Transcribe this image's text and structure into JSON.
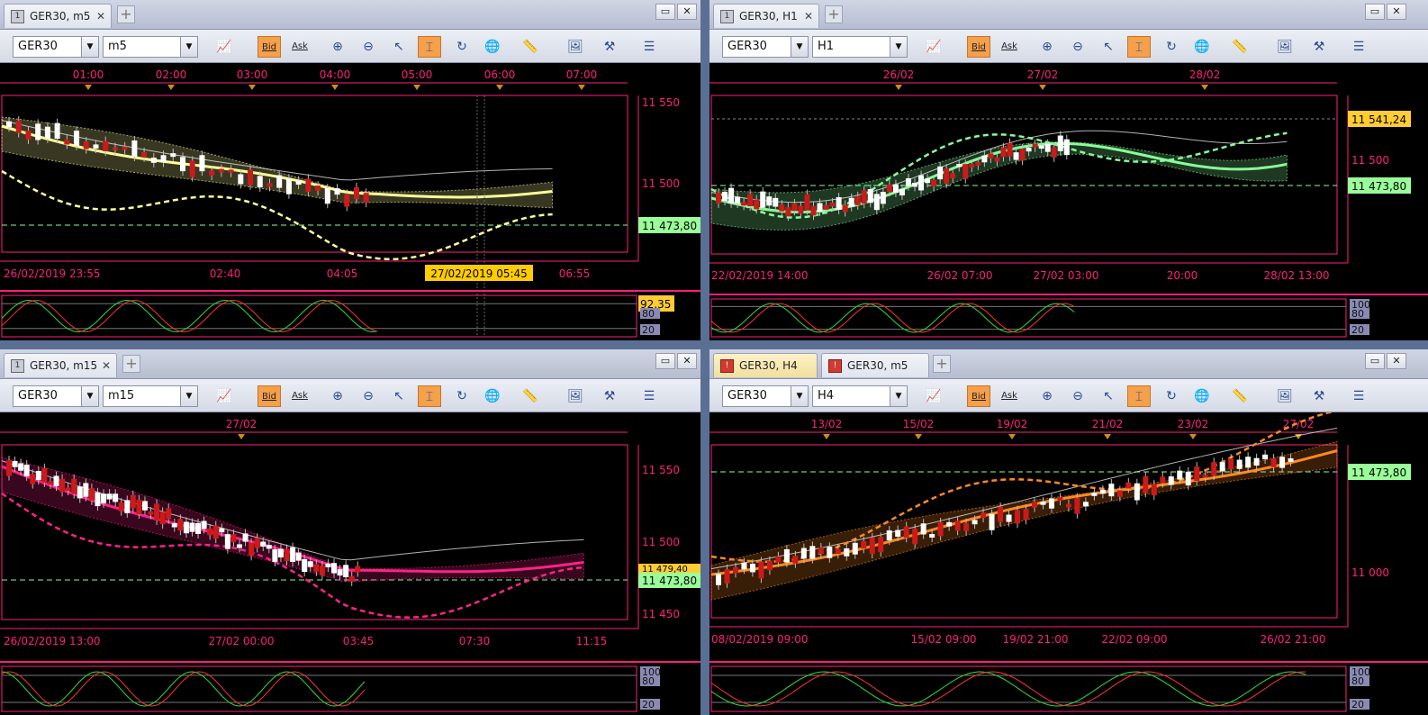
{
  "panes": [
    {
      "id": "tl",
      "tabs": [
        {
          "label": "GER30, m5",
          "active": false,
          "icon": "gray"
        }
      ],
      "symbol": "GER30",
      "timeframe": "m5",
      "bid_label": "Bid",
      "ask_label": "Ask",
      "top_axis": [
        "01:00",
        "02:00",
        "03:00",
        "04:00",
        "05:00",
        "06:00",
        "07:00"
      ],
      "price_labels": [
        "11 550",
        "11 500"
      ],
      "current_price": "11 473,80",
      "bottom_axis": [
        "26/02/2019 23:55",
        "02:40",
        "04:05",
        "06:55"
      ],
      "cursor_label": "27/02/2019 05:45",
      "osc_value": "92,35",
      "osc_levels": [
        "80",
        "20"
      ],
      "color": "#ffff99"
    },
    {
      "id": "tr",
      "tabs": [
        {
          "label": "GER30, H1",
          "active": false,
          "icon": "gray"
        }
      ],
      "symbol": "GER30",
      "timeframe": "H1",
      "bid_label": "Bid",
      "ask_label": "Ask",
      "top_axis": [
        "26/02",
        "27/02",
        "28/02"
      ],
      "price_labels": [
        "11 500"
      ],
      "high_price": "11 541,24",
      "current_price": "11 473,80",
      "bottom_axis": [
        "22/02/2019 14:00",
        "26/02 07:00",
        "27/02 03:00",
        "20:00",
        "28/02 13:00"
      ],
      "osc_levels": [
        "100",
        "80",
        "20"
      ],
      "color": "#88ff99"
    },
    {
      "id": "bl",
      "tabs": [
        {
          "label": "GER30, m15",
          "active": false,
          "icon": "gray"
        }
      ],
      "symbol": "GER30",
      "timeframe": "m15",
      "bid_label": "Bid",
      "ask_label": "Ask",
      "top_axis": [
        "27/02"
      ],
      "price_labels": [
        "11 550",
        "11 500",
        "11 450"
      ],
      "extra_price": "11 479,40",
      "current_price": "11 473,80",
      "bottom_axis": [
        "26/02/2019 13:00",
        "27/02 00:00",
        "03:45",
        "07:30",
        "11:15"
      ],
      "osc_levels": [
        "100",
        "80",
        "20"
      ],
      "color": "#ff2288"
    },
    {
      "id": "br",
      "tabs": [
        {
          "label": "GER30, H4",
          "active": true,
          "icon": "red"
        },
        {
          "label": "GER30, m5",
          "active": false,
          "icon": "red"
        }
      ],
      "symbol": "GER30",
      "timeframe": "H4",
      "bid_label": "Bid",
      "ask_label": "Ask",
      "top_axis": [
        "13/02",
        "15/02",
        "19/02",
        "21/02",
        "23/02",
        "27/02"
      ],
      "price_labels": [
        "11 000"
      ],
      "current_price": "11 473,80",
      "bottom_axis": [
        "08/02/2019 09:00",
        "15/02 09:00",
        "19/02 21:00",
        "22/02 09:00",
        "26/02 21:00"
      ],
      "osc_levels": [
        "100",
        "80",
        "20"
      ],
      "color": "#ff8a22"
    }
  ]
}
